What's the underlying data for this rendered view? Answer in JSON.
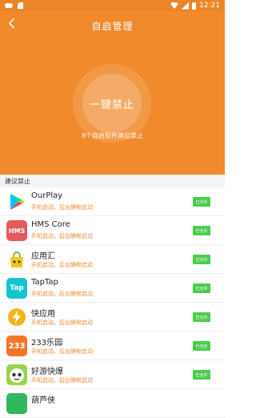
{
  "status_bar": {
    "time": "12:21"
  },
  "header": {
    "title": "自启管理",
    "main_button_label": "一键禁止",
    "hint": "8个自启软件建议禁止",
    "bg_color": "#f08a2c"
  },
  "section": {
    "title": "建议禁止"
  },
  "apps": [
    {
      "name": "OurPlay",
      "status": "开机启动，后台静默启动",
      "toggle": "已允许",
      "icon": "play-store-icon"
    },
    {
      "name": "HMS Core",
      "status": "开机启动，后台静默启动",
      "toggle": "已允许",
      "icon": "hms-core-icon",
      "icon_text": "HMS"
    },
    {
      "name": "应用汇",
      "status": "开机启动，后台静默启动",
      "toggle": "已允许",
      "icon": "appchina-icon"
    },
    {
      "name": "TapTap",
      "status": "开机启动，后台静默启动",
      "toggle": "已允许",
      "icon": "taptap-icon",
      "icon_text": "Tap"
    },
    {
      "name": "快应用",
      "status": "开机启动，后台静默启动",
      "toggle": "已允许",
      "icon": "quick-app-icon"
    },
    {
      "name": "233乐园",
      "status": "开机启动，后台静默启动",
      "toggle": "已允许",
      "icon": "233-icon",
      "icon_text": "233"
    },
    {
      "name": "好游快爆",
      "status": "开机启动，后台静默启动",
      "toggle": "已允许",
      "icon": "haoyou-icon"
    },
    {
      "name": "葫芦侠",
      "status": "",
      "toggle": "",
      "icon": "huluxia-icon"
    }
  ]
}
